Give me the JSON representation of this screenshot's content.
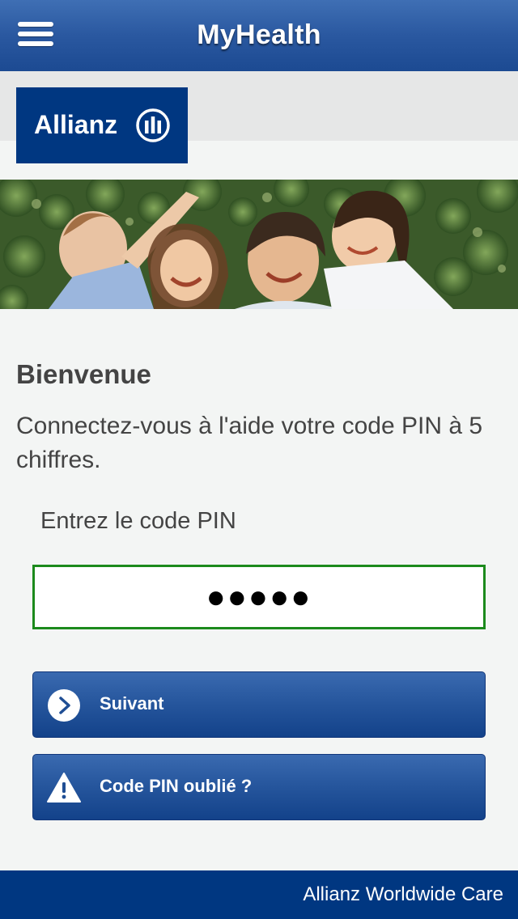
{
  "header": {
    "title": "MyHealth",
    "menu_icon": "hamburger-menu-icon"
  },
  "brand": {
    "logo_text": "Allianz",
    "logo_icon": "allianz-eagle-icon",
    "logo_color": "#003781"
  },
  "hero": {
    "image": "family-photo"
  },
  "login": {
    "heading": "Bienvenue",
    "intro": "Connectez-vous à l'aide votre code PIN à 5 chiffres.",
    "pin_label": "Entrez le code PIN",
    "pin_value": "●●●●●",
    "field_border_color": "#1c8a1c"
  },
  "buttons": {
    "next_label": "Suivant",
    "next_icon": "chevron-right-icon",
    "forgot_label": "Code PIN oublié ?",
    "forgot_icon": "warning-icon"
  },
  "footer": {
    "text": "Allianz Worldwide Care"
  },
  "colors": {
    "header_blue": "#2a58a0",
    "footer_blue": "#003781",
    "background": "#f3f5f4"
  }
}
